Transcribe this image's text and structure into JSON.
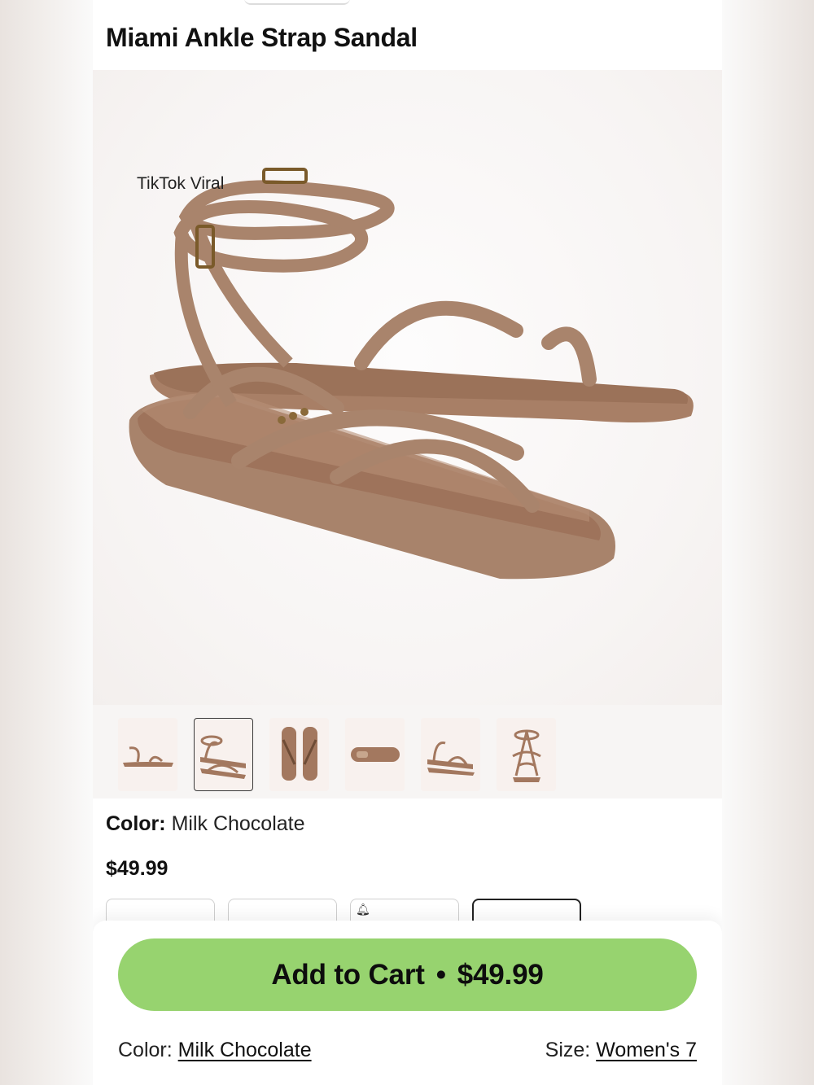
{
  "product": {
    "title": "Miami Ankle Strap Sandal",
    "badge": "TikTok Viral",
    "color_label": "Color:",
    "color_value": "Milk Chocolate",
    "price": "$49.99"
  },
  "thumbnails": [
    {
      "name": "side view"
    },
    {
      "name": "pair view",
      "selected": true
    },
    {
      "name": "top view"
    },
    {
      "name": "sole view"
    },
    {
      "name": "pair side view"
    },
    {
      "name": "front view"
    }
  ],
  "sheet": {
    "cta_label": "Add to Cart",
    "cta_sep": "•",
    "cta_price": "$49.99",
    "color_label": "Color:",
    "color_value": "Milk Chocolate",
    "size_label": "Size:",
    "size_value": "Women's 7"
  },
  "colors": {
    "cta": "#97d36f",
    "sandal": "#a9846c"
  }
}
